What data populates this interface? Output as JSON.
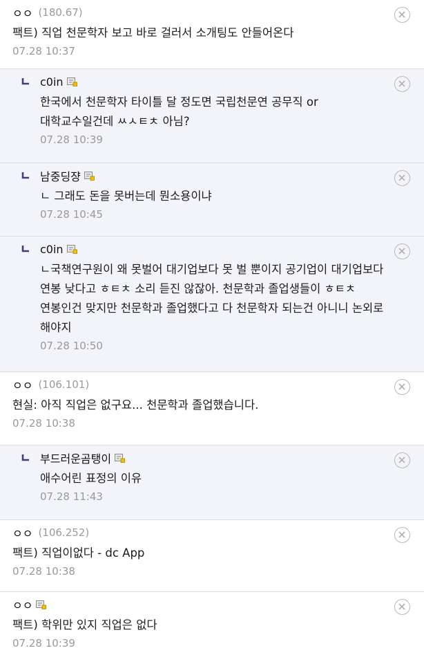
{
  "comments": [
    {
      "type": "comment",
      "nick": "ㅇㅇ",
      "ip": "(180.67)",
      "text": "팩트) 직업 천문학자 보고 바로 걸러서 소개팅도 안들어온다",
      "date": "07.28 10:37"
    },
    {
      "type": "reply",
      "nick": "c0in",
      "text": "한국에서 천문학자 타이틀 달 정도면 국립천문연 공무직 or 대학교수일건데 ㅆㅅㅌㅊ 아님?",
      "date": "07.28 10:39"
    },
    {
      "type": "reply",
      "nick": "남중딩쟝",
      "text": "ㄴ 그래도 돈을 못버는데 뭔소용이냐",
      "date": "07.28 10:45"
    },
    {
      "type": "reply",
      "nick": "c0in",
      "text": "ㄴ국책연구원이 왜 못벌어 대기업보다 못 벌 뿐이지 공기업이 대기업보다 연봉 낮다고 ㅎㅌㅊ 소리 듣진 않잖아. 천문학과 졸업생들이 ㅎㅌㅊ 연봉인건 맞지만 천문학과 졸업했다고 다 천문학자 되는건 아니니 논외로 해야지",
      "date": "07.28 10:50"
    },
    {
      "type": "comment",
      "nick": "ㅇㅇ",
      "ip": "(106.101)",
      "text": "현실: 아직 직업은 없구요... 천문학과 졸업했습니다.",
      "date": "07.28 10:38"
    },
    {
      "type": "reply",
      "nick": "부드러운곰탱이",
      "text": "애수어린 표정의 이유",
      "date": "07.28 11:43"
    },
    {
      "type": "comment",
      "nick": "ㅇㅇ",
      "ip": "(106.252)",
      "text": "팩트) 직업이없다 - dc App",
      "date": "07.28 10:38"
    },
    {
      "type": "comment",
      "nick": "ㅇㅇ",
      "ip": "",
      "text": "팩트) 학위만 있지 직업은 없다",
      "date": "07.28 10:39"
    }
  ]
}
